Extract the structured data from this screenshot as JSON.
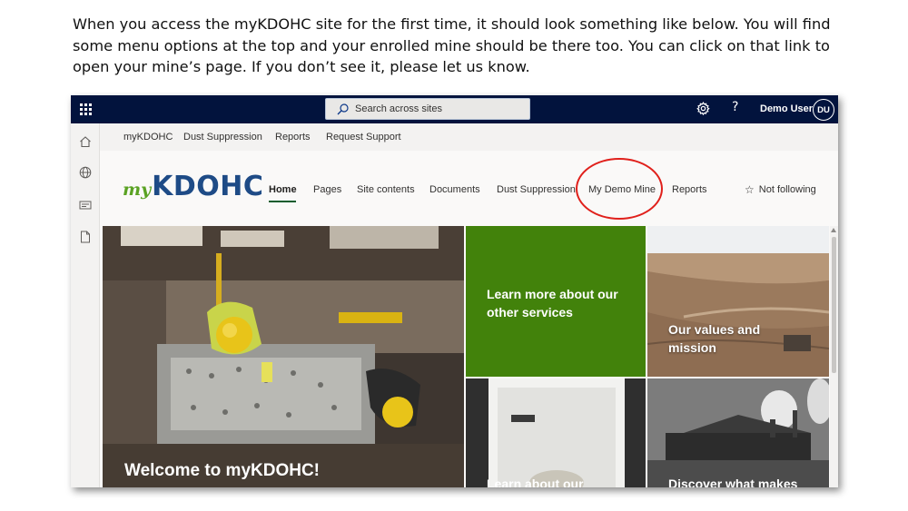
{
  "intro_text": "When you access the myKDOHC site for the first time, it should look something like below. You will find some menu options at the top and your enrolled mine should be there too. You can click on that link to open your mine’s page. If you don’t see it, please let us know.",
  "suite_bar": {
    "search_placeholder": "Search across sites",
    "user_name": "Demo User",
    "user_initials": "DU",
    "help_label": "?",
    "background_color": "#02133d"
  },
  "app_bar": {
    "icons": [
      "home-icon",
      "globe-icon",
      "news-icon",
      "document-icon"
    ]
  },
  "hub_nav": {
    "items": [
      "myKDOHC",
      "Dust Suppression",
      "Reports",
      "Request Support"
    ]
  },
  "site": {
    "logo_prefix": "my",
    "logo_main": "KDOHC",
    "nav": [
      "Home",
      "Pages",
      "Site contents",
      "Documents",
      "Dust Suppression",
      "My Demo Mine",
      "Reports"
    ],
    "active_nav": "Home",
    "highlighted_nav": "My Demo Mine",
    "follow_label": "Not following",
    "accent_color": "#0d5c2e"
  },
  "hero": {
    "main_title": "Welcome to myKDOHC!",
    "tiles": [
      "Learn more about our other services",
      "Our values and mission",
      "Learn about our",
      "Discover what makes"
    ]
  },
  "colors": {
    "highlight_circle": "#e0201b",
    "green_tile": "#42820b",
    "logo_green": "#5aa223",
    "logo_blue": "#1e4b86"
  }
}
